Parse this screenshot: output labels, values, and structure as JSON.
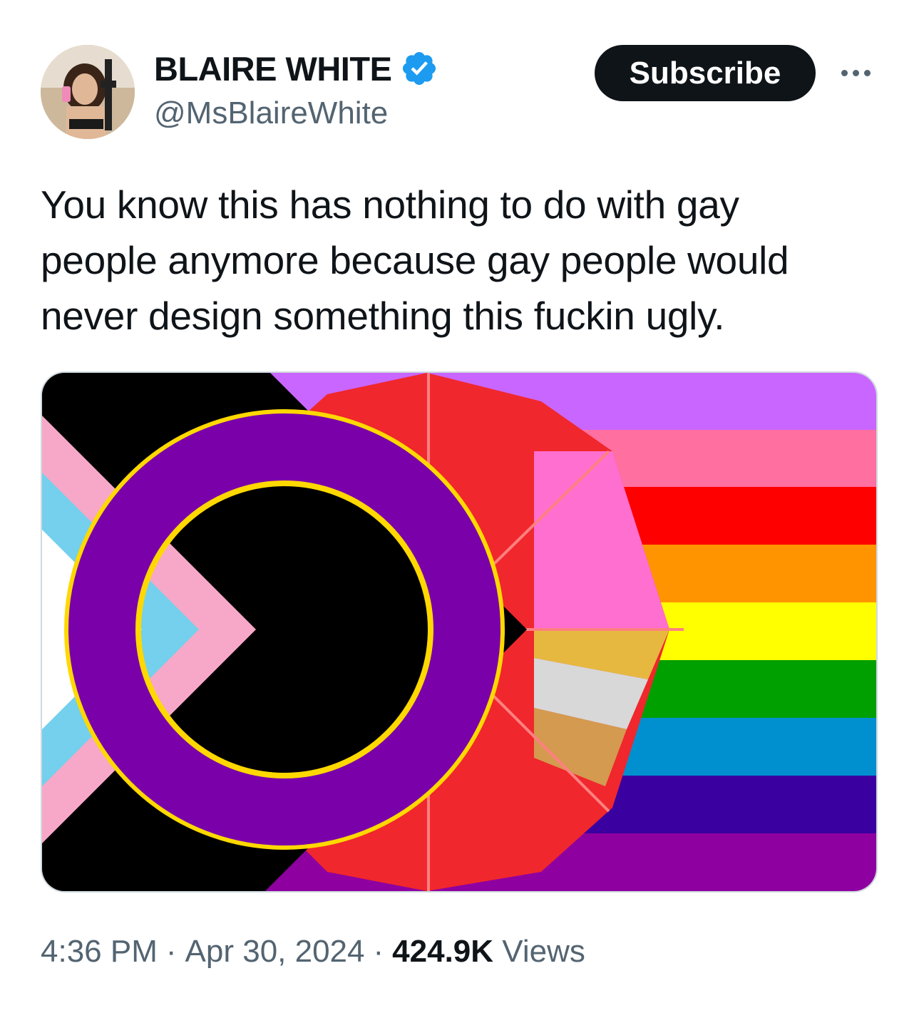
{
  "author": {
    "display_name": "BLAIRE WHITE",
    "handle": "@MsBlaireWhite",
    "verified": true,
    "verified_color": "#1d9bf0",
    "avatar": "profile-photo"
  },
  "actions": {
    "subscribe_label": "Subscribe",
    "more_icon": "ellipsis-icon"
  },
  "tweet": {
    "text": "You know this has nothing to do with gay\npeople anymore because gay people would\nnever design something this fuckin ugly.",
    "media": "flag-image"
  },
  "meta": {
    "time": "4:36 PM",
    "date": "Apr 30, 2024",
    "separator": "·",
    "views_count": "424.9K",
    "views_label": "Views"
  },
  "colors": {
    "text_primary": "#0f1419",
    "text_secondary": "#536471",
    "button_bg": "#0f1419",
    "button_text": "#ffffff",
    "media_border": "#cfd9de"
  }
}
